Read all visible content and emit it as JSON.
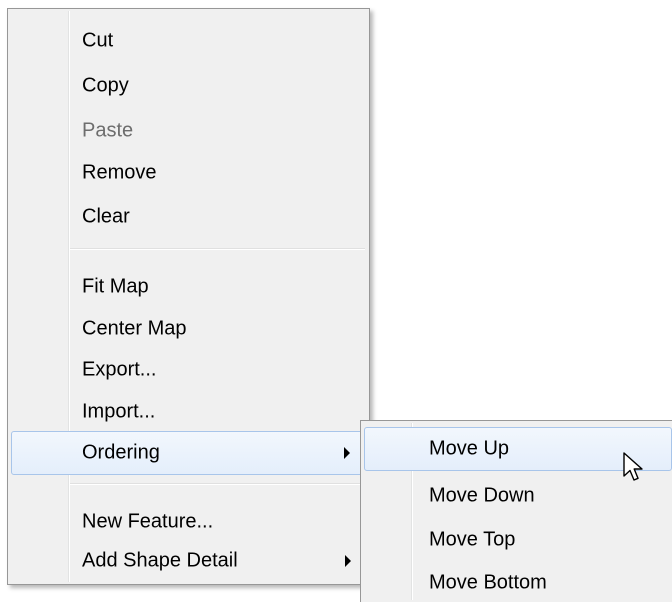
{
  "context_menu": {
    "groups": [
      [
        {
          "label": "Cut",
          "enabled": true
        },
        {
          "label": "Copy",
          "enabled": true
        },
        {
          "label": "Paste",
          "enabled": false
        },
        {
          "label": "Remove",
          "enabled": true
        },
        {
          "label": "Clear",
          "enabled": true
        }
      ],
      [
        {
          "label": "Fit Map",
          "enabled": true
        },
        {
          "label": "Center Map",
          "enabled": true
        },
        {
          "label": "Export...",
          "enabled": true
        },
        {
          "label": "Import...",
          "enabled": true
        },
        {
          "label": "Ordering",
          "enabled": true,
          "has_submenu": true,
          "highlighted": true
        }
      ],
      [
        {
          "label": "New Feature...",
          "enabled": true
        },
        {
          "label": "Add Shape Detail",
          "enabled": true,
          "has_submenu": true
        }
      ]
    ]
  },
  "ordering_submenu": {
    "items": [
      {
        "label": "Move Up",
        "highlighted": true
      },
      {
        "label": "Move Down"
      },
      {
        "label": "Move Top"
      },
      {
        "label": "Move Bottom"
      }
    ]
  },
  "colors": {
    "menu_background": "#f0f0f0",
    "menu_border": "#979797",
    "highlight_border": "#a8c5ea",
    "highlight_fill": "#e4eefb",
    "disabled_text": "#6d6d6d"
  },
  "icons": {
    "submenu_arrow": "triangle-right",
    "cursor": "arrow-pointer"
  }
}
